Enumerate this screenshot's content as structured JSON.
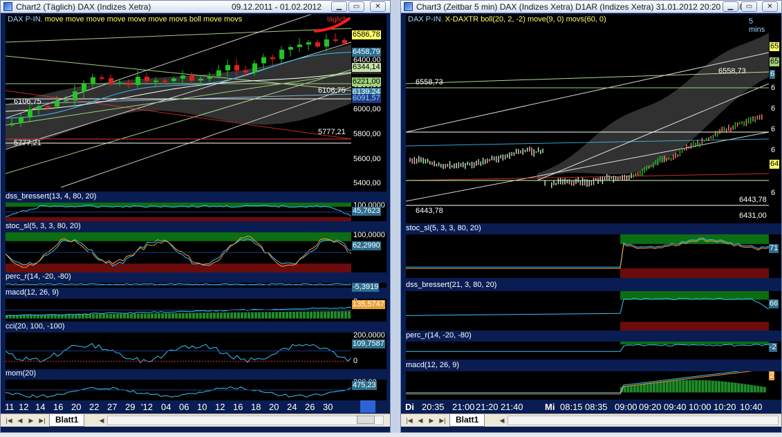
{
  "left_window": {
    "title": "Chart2 (Täglich)  DAX (Indizes Xetra)",
    "date_range": "09.12.2011 - 01.02.2012",
    "main_label": "DAX P-IN.",
    "main_indicators": "move move move move move move movs boll move movs",
    "annotation": "täglich",
    "y_ticks": [
      "6400,00",
      "6200,00",
      "6000,00",
      "5800,00",
      "5600,00",
      "5400,00"
    ],
    "tags": [
      {
        "text": "6586,78",
        "bg": "#ffff66",
        "fg": "#000000"
      },
      {
        "text": "6458,79",
        "bg": "#2c6f8e",
        "fg": "#ffffff"
      },
      {
        "text": "6377,34",
        "bg": "#2a2a2a",
        "fg": "#ffffff"
      },
      {
        "text": "6344,14",
        "bg": "#c9e2a8",
        "fg": "#000000"
      },
      {
        "text": "6221,00",
        "bg": "#9fd07a",
        "fg": "#000000"
      },
      {
        "text": "6139,24",
        "bg": "#3b7fa0",
        "fg": "#ffffff"
      },
      {
        "text": "6091,57",
        "bg": "#1d3a88",
        "fg": "#9ad8ff"
      }
    ],
    "level_labels": [
      "6106,75",
      "6106,75",
      "5777,21",
      "5777,21"
    ],
    "panes": [
      {
        "label": "dss_bressert(13, 4, 80, 20)",
        "ticks": [
          "100,0000"
        ],
        "tag": "45,7623",
        "tag_bg": "#2c6f8e"
      },
      {
        "label": "stoc_sl(5, 3, 3, 80, 20)",
        "ticks": [
          "100,0000"
        ],
        "tag": "62,2990",
        "tag_bg": "#2c6f8e"
      },
      {
        "label": "perc_r(14, -20, -80)",
        "ticks": [],
        "tag": "-5,3919",
        "tag_bg": "#2c6f8e"
      },
      {
        "label": "macd(12, 26, 9)",
        "ticks": [
          "0"
        ],
        "tag": "135,5747",
        "tag_bg": "#e9a13a"
      },
      {
        "label": "cci(20, 100, -100)",
        "ticks": [
          "200,0000",
          "0"
        ],
        "tag": "109,7587",
        "tag_bg": "#2c6f8e"
      },
      {
        "label": "mom(20)",
        "ticks": [
          "200,00"
        ],
        "tag": "475,23",
        "tag_bg": "#2c6f8e"
      }
    ],
    "x_labels": [
      "11",
      "12",
      "14",
      "16",
      "20",
      "22",
      "27",
      "29",
      "'12",
      "04",
      "06",
      "10",
      "12",
      "16",
      "18",
      "20",
      "24",
      "26",
      "30"
    ],
    "sheet_tab": "Blatt1"
  },
  "right_window": {
    "title": "Chart3 (Zeitbar 5 min)  DAX (Indizes Xetra) D1AR (Indizes Xetra) 31.01.2012 20:20 - 01.02...",
    "main_label": "DAX P-IN.",
    "main_indicators": "X-DAXTR boll(20, 2, -2) move(9, 0) movs(60, 0)",
    "timeframe": "5 mins",
    "tags": [
      {
        "text": "65",
        "bg": "#ffff66",
        "fg": "#000000"
      },
      {
        "text": "65",
        "bg": "#9fd07a",
        "fg": "#000000"
      },
      {
        "text": "6",
        "bg": "#2c6f8e",
        "fg": "#ffffff"
      },
      {
        "text": "64",
        "bg": "#ffff66",
        "fg": "#000000"
      }
    ],
    "right_ticks": [
      "6",
      "6",
      "6",
      "6",
      "6"
    ],
    "level_labels": [
      "6558,73",
      "6558,73",
      "6443,78",
      "6443,78",
      "6431,00"
    ],
    "panes": [
      {
        "label": "stoc_sl(5, 3, 3, 80, 20)",
        "tag": "71",
        "tag_bg": "#2c6f8e"
      },
      {
        "label": "dss_bressert(21, 3, 80, 20)",
        "tag": "66",
        "tag_bg": "#2c6f8e"
      },
      {
        "label": "perc_r(14, -20, -80)",
        "tag": "-2",
        "tag_bg": "#2c6f8e"
      },
      {
        "label": "macd(12, 26, 9)",
        "tag": "2",
        "tag_bg": "#e9a13a"
      }
    ],
    "x_labels": [
      "Di",
      "20:35",
      "21:00",
      "21:20",
      "21:40",
      "Mi",
      "08:15",
      "08:35",
      "09:00",
      "09:20",
      "09:40",
      "10:00",
      "10:20",
      "10:40"
    ],
    "sheet_tab": "Blatt1"
  },
  "colors": {
    "frame": "#0a1d52",
    "bullish": "#22c422",
    "bearish": "#e21e1e",
    "band": "#3a3a3a",
    "overbought": "#0c6d12",
    "oversold": "#6b0c0c"
  }
}
